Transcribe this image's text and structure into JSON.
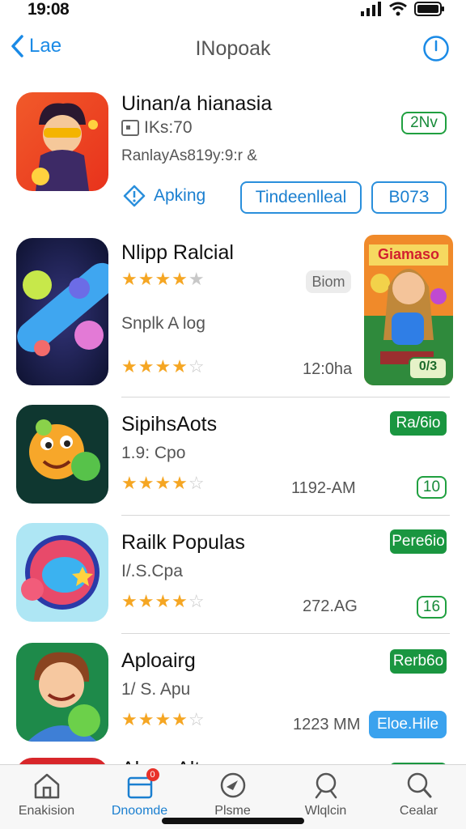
{
  "status": {
    "time": "19:08"
  },
  "nav": {
    "back_label": "Lae",
    "title": "INopoak"
  },
  "apps": [
    {
      "name": "Uinan/a hianasia",
      "subtitle": "IKs:70",
      "subtitle2": "RanlayAs819y:9:r &",
      "badge": "2Nv",
      "action_label": "Apking",
      "button_mid": "Tindeenlleal",
      "button_right": "B07З"
    },
    {
      "name": "Nlipp Ralcial",
      "badge": "Biom",
      "subtitle": "Snplk A log",
      "time": "12:0ha",
      "promo_title": "Giamaso",
      "promo_badge": "0/3",
      "rating1": 4,
      "rating2": 3.5
    },
    {
      "name": "SipihsAots",
      "subtitle": "1.9: Cpo",
      "time": "1192-AM",
      "badge": "Ra/6io",
      "badge2": "10",
      "rating": 4
    },
    {
      "name": "Railk Populas",
      "subtitle": "I/.S.Cpa",
      "time": "272.AG",
      "badge": "Pere6io",
      "badge2": "16",
      "rating": 4
    },
    {
      "name": "Aploairg",
      "subtitle": "1/ S. Apu",
      "time": "1223 MM",
      "badge": "Rerb6o",
      "badge2": "Eloe.Hile",
      "rating": 4
    },
    {
      "name": "Alsap Alte"
    }
  ],
  "tabs": [
    {
      "label": "Enakision"
    },
    {
      "label": "Dnoomde",
      "badge": "0"
    },
    {
      "label": "Plsme"
    },
    {
      "label": "Wlqlcin"
    },
    {
      "label": "Cealar"
    }
  ]
}
